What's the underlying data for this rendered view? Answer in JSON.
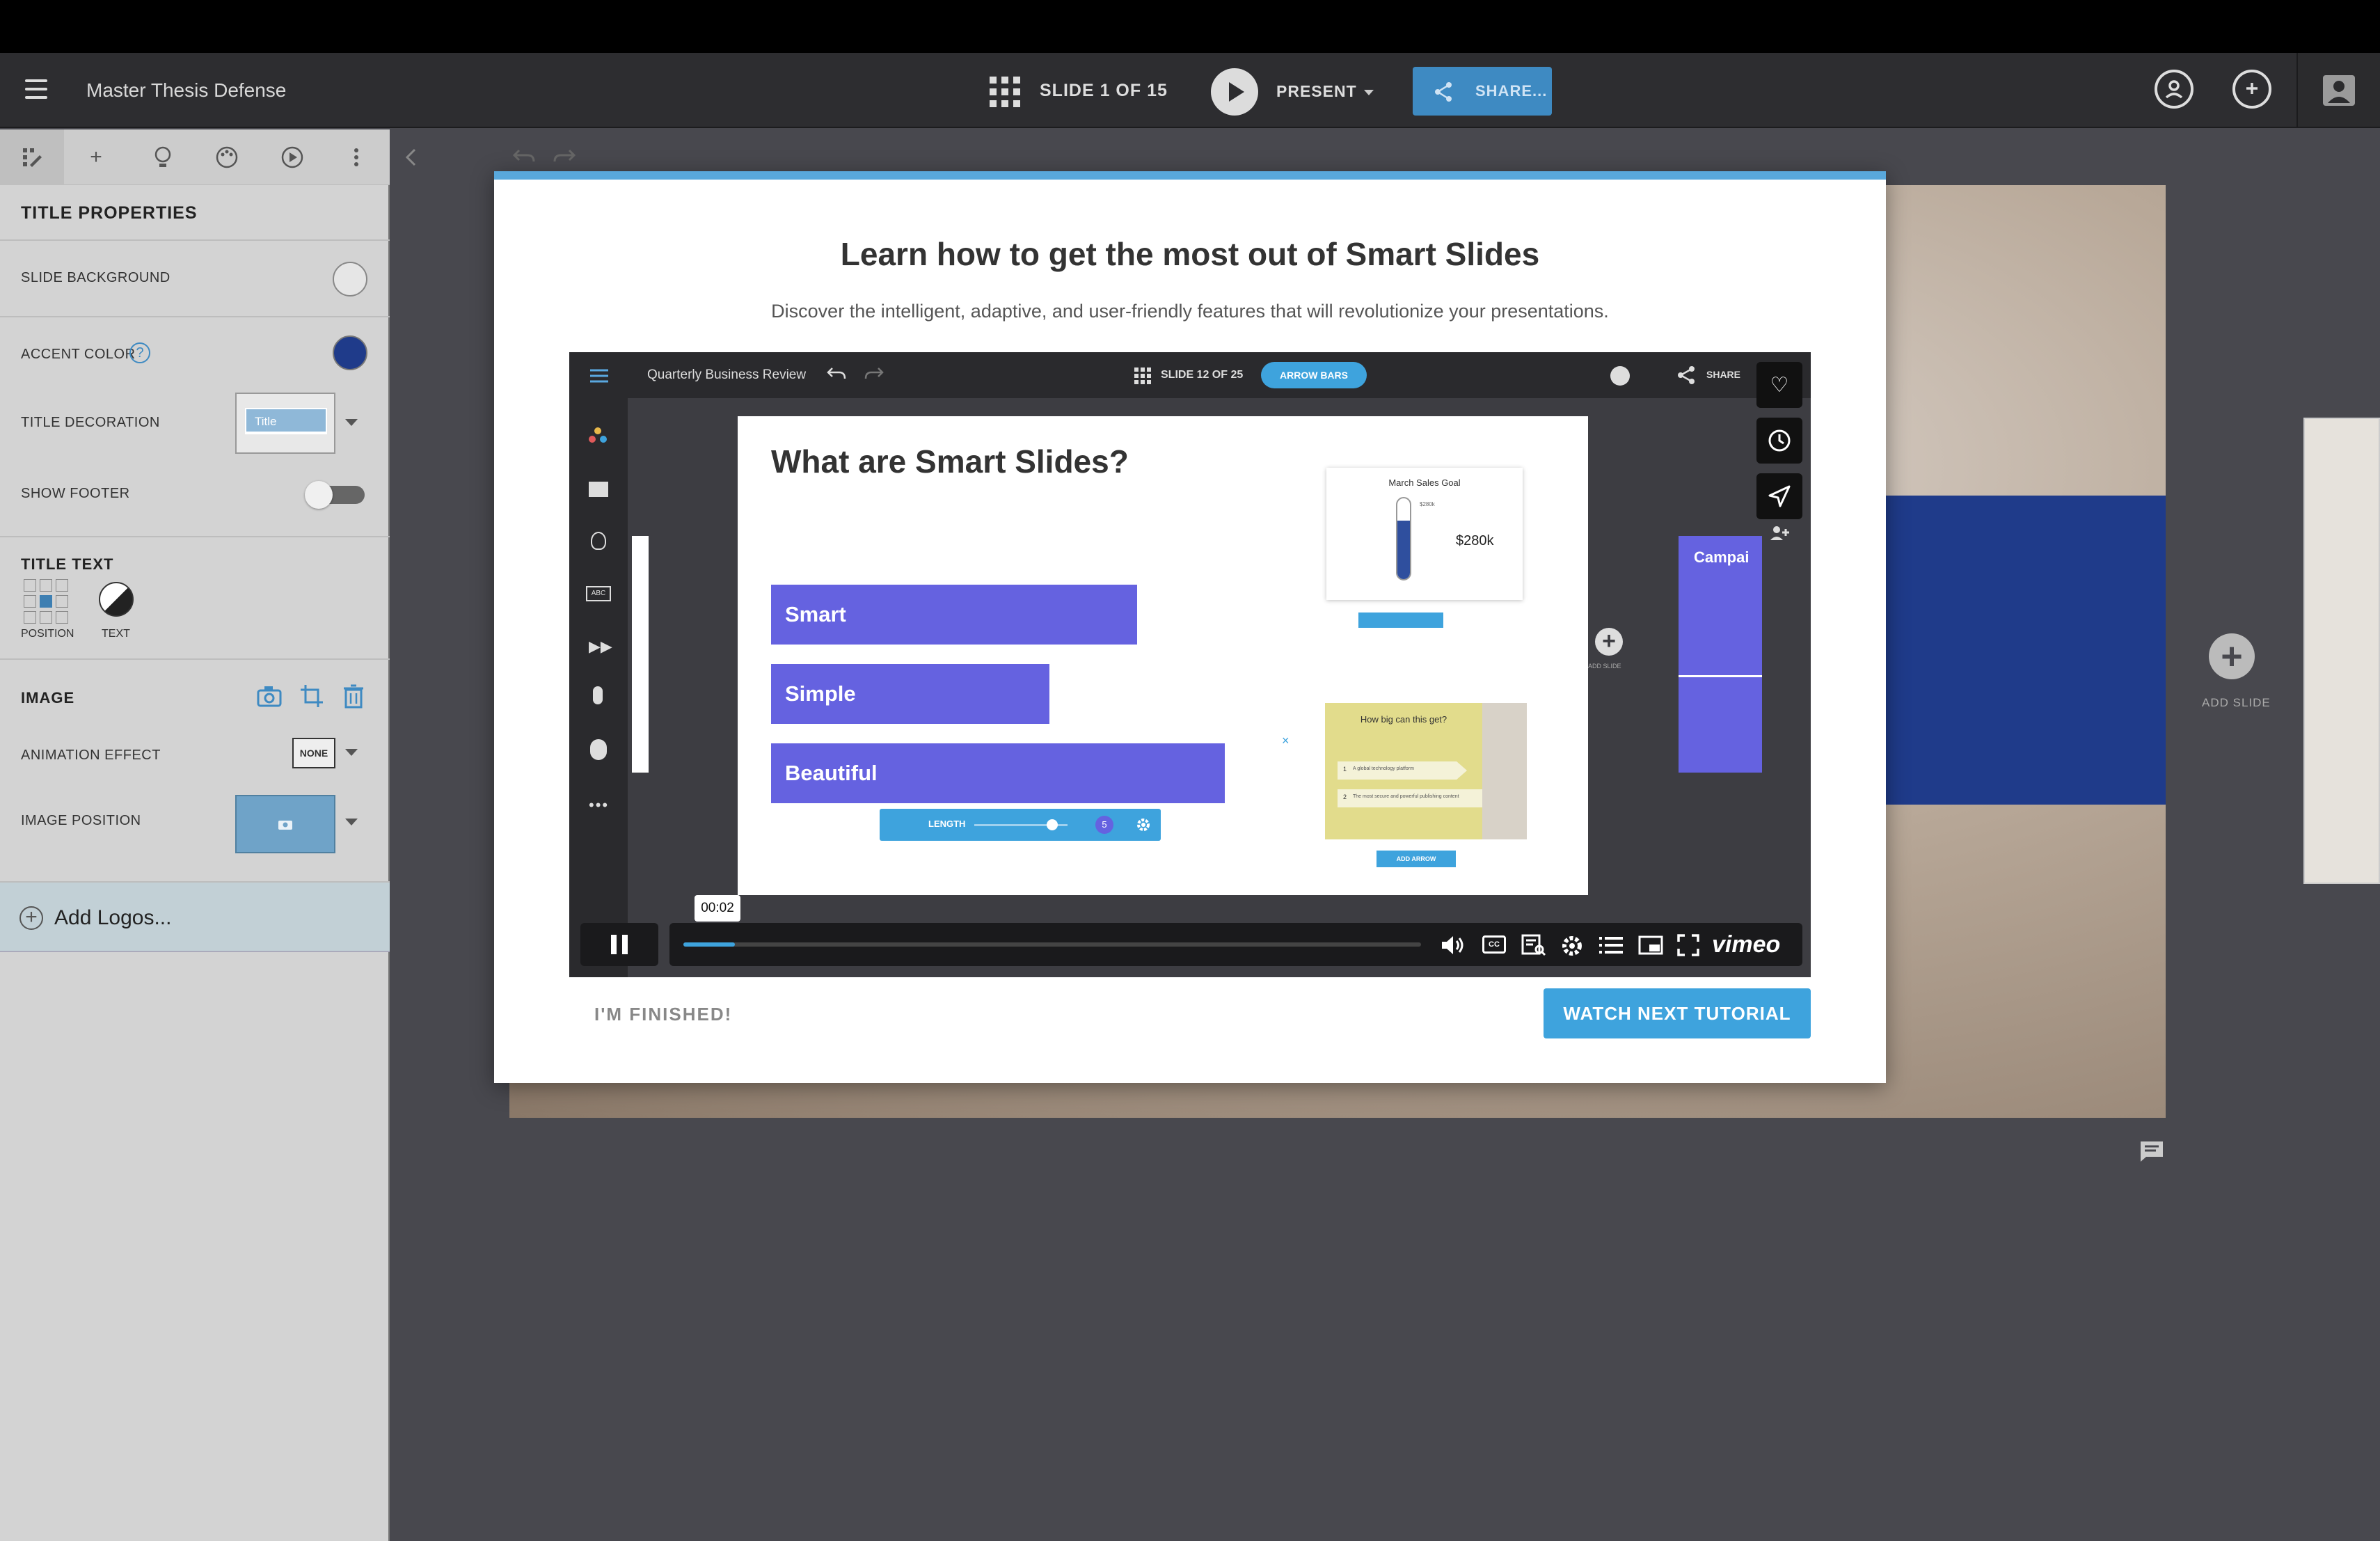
{
  "topbar": {
    "menu_icon": "hamburger-icon",
    "doc_title": "Master Thesis Defense",
    "slide_counter": "SLIDE 1 OF 15",
    "present_label": "PRESENT",
    "share_label": "SHARE...",
    "right_icons": [
      "user-circle-icon",
      "comment-add-icon",
      "account-icon"
    ]
  },
  "panel": {
    "tabs": [
      "magic-wand-icon",
      "plus-icon",
      "lightbulb-icon",
      "palette-icon",
      "play-circle-icon",
      "more-vertical-icon"
    ],
    "section_title": "TITLE PROPERTIES",
    "slide_background": "SLIDE BACKGROUND",
    "accent_color": "ACCENT COLOR",
    "accent_hex": "#1f3b8a",
    "title_decoration": "TITLE DECORATION",
    "title_decoration_value": "Title",
    "show_footer": "SHOW FOOTER",
    "title_text": "TITLE TEXT",
    "position": "POSITION",
    "text": "TEXT",
    "image": "IMAGE",
    "animation_effect": "ANIMATION EFFECT",
    "animation_value": "NONE",
    "image_position": "IMAGE POSITION",
    "add_logos": "Add Logos..."
  },
  "canvas": {
    "add_slide": "ADD SLIDE"
  },
  "modal": {
    "title": "Learn how to get the most out of Smart Slides",
    "subtitle": "Discover the intelligent, adaptive, and user-friendly features that will revolutionize your presentations.",
    "finished_label": "I'M FINISHED!",
    "next_label": "WATCH NEXT TUTORIAL",
    "accent": "#59a8dc"
  },
  "video": {
    "doc_title": "Quarterly Business Review",
    "slide_counter": "SLIDE 12 OF 25",
    "pill": "ARROW BARS",
    "share": "SHARE",
    "slide_title": "What are Smart Slides?",
    "bars": [
      "Smart",
      "Simple",
      "Beautiful"
    ],
    "length_label": "LENGTH",
    "length_value": "5",
    "goal_title": "March Sales Goal",
    "goal_value": "$280k",
    "goal_small": "$280k",
    "how_big": "How big can this get?",
    "how_big_items": [
      {
        "n": "1",
        "t": "A global technology platform"
      },
      {
        "n": "2",
        "t": "The most secure and powerful publishing content"
      }
    ],
    "add_arrow": "ADD ARROW",
    "add_slide": "ADD SLIDE",
    "campaign": "Campai",
    "timestamp": "00:02",
    "progress_fraction": 0.07,
    "vimeo": "vimeo"
  }
}
